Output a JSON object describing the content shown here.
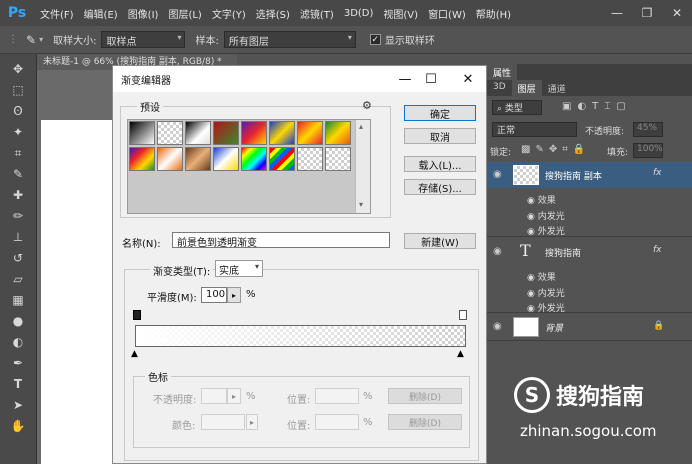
{
  "app": {
    "logo": "Ps"
  },
  "menu": [
    "文件(F)",
    "编辑(E)",
    "图像(I)",
    "图层(L)",
    "文字(Y)",
    "选择(S)",
    "滤镜(T)",
    "3D(D)",
    "视图(V)",
    "窗口(W)",
    "帮助(H)"
  ],
  "window_controls": {
    "minimize": "—",
    "restore": "❐",
    "close": "✕"
  },
  "options_bar": {
    "sample_size_label": "取样大小:",
    "sample_size_value": "取样点",
    "sample_label": "样本:",
    "sample_value": "所有图层",
    "show_ring_label": "显示取样环",
    "show_ring_checked": "✓"
  },
  "document": {
    "tab_title": "未标题-1 @ 66% (搜狗指南 副本, RGB/8) *",
    "tab_close": "×"
  },
  "tools": [
    "move-tool-icon",
    "marquee-tool-icon",
    "lasso-tool-icon",
    "magic-wand-tool-icon",
    "crop-tool-icon",
    "eyedropper-tool-icon",
    "healing-tool-icon",
    "brush-tool-icon",
    "stamp-tool-icon",
    "history-brush-tool-icon",
    "eraser-tool-icon",
    "gradient-tool-icon",
    "blur-tool-icon",
    "dodge-tool-icon",
    "pen-tool-icon",
    "type-tool-icon",
    "path-select-tool-icon",
    "hand-tool-icon"
  ],
  "panels": {
    "top_tabs": [
      "属性"
    ],
    "tabs": [
      "3D",
      "图层",
      "通道"
    ],
    "filter_label": "类型",
    "blend_mode": "正常",
    "opacity_label": "不透明度:",
    "opacity_value": "45%",
    "lock_label": "锁定:",
    "fill_label": "填充:",
    "fill_value": "100%",
    "layers": [
      {
        "name": "搜狗指南 副本",
        "fx": "fx",
        "effects_label": "效果",
        "effects": [
          "内发光",
          "外发光"
        ]
      },
      {
        "name": "搜狗指南",
        "fx": "fx",
        "type_glyph": "T",
        "effects_label": "效果",
        "effects": [
          "内发光",
          "外发光"
        ]
      },
      {
        "name": "背景"
      }
    ]
  },
  "dialog": {
    "title": "渐变编辑器",
    "presets_label": "预设",
    "buttons": {
      "ok": "确定",
      "cancel": "取消",
      "load": "载入(L)...",
      "save": "存储(S)...",
      "new": "新建(W)"
    },
    "name_label": "名称(N):",
    "name_value": "前景色到透明渐变",
    "gradient_type_label": "渐变类型(T):",
    "gradient_type_value": "实底",
    "smoothness_label": "平滑度(M):",
    "smoothness_value": "100",
    "smoothness_unit": "%",
    "stops_label": "色标",
    "opacity_label": "不透明度:",
    "color_label": "颜色:",
    "location_label": "位置:",
    "percent": "%",
    "delete_label": "删除(D)"
  },
  "watermark": {
    "logo": "S",
    "text": "搜狗指南",
    "url": "zhinan.sogou.com"
  }
}
